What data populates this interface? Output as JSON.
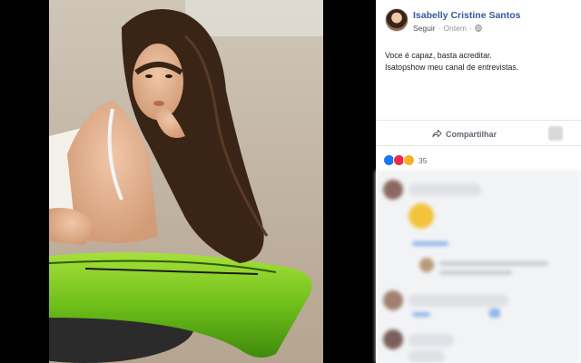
{
  "post": {
    "author": "Isabelly Cristine Santos",
    "follow_label": "Seguir",
    "timestamp": "Ontem",
    "privacy_icon": "globe-icon",
    "text_lines": [
      "Voce é capaz, basta acreditar.",
      "Isatopshow meu canal de entrevistas."
    ],
    "share_label": "Compartilhar",
    "share_icon": "share-arrow-icon"
  },
  "reactions": {
    "types": [
      "like",
      "love",
      "wow"
    ],
    "count": "35"
  },
  "colors": {
    "link_blue": "#365899",
    "surfboard_green": "#7ac21e",
    "comment_bg": "#f2f3f5"
  }
}
